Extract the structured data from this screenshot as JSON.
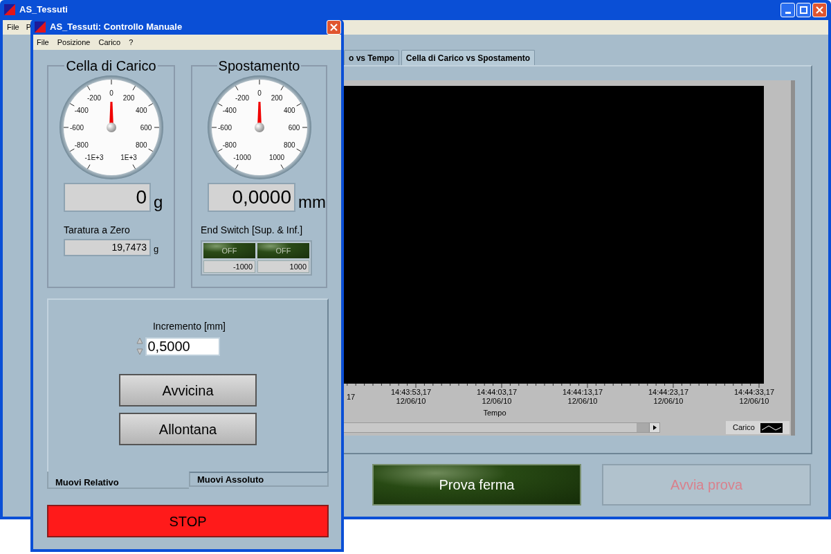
{
  "main_window": {
    "title": "AS_Tessuti",
    "menu": [
      "File",
      "P"
    ],
    "tabs": [
      {
        "label": "o vs Tempo",
        "selected": false
      },
      {
        "label": "Cella di Carico vs Spostamento",
        "selected": true
      }
    ],
    "graph": {
      "x_ticks": [
        {
          "time": "17"
        },
        {
          "time": "14:43:53,17",
          "date": "12/06/10"
        },
        {
          "time": "14:44:03,17",
          "date": "12/06/10"
        },
        {
          "time": "14:44:13,17",
          "date": "12/06/10"
        },
        {
          "time": "14:44:23,17",
          "date": "12/06/10"
        },
        {
          "time": "14:44:33,17",
          "date": "12/06/10"
        }
      ],
      "x_label": "Tempo",
      "legend": "Carico"
    },
    "buttons": [
      {
        "label": "Prova ferma",
        "kind": "led",
        "disabled": false
      },
      {
        "label": "Avvia prova",
        "kind": "plain",
        "disabled": true
      }
    ]
  },
  "dialog": {
    "title": "AS_Tessuti: Controllo Manuale",
    "menu": [
      "File",
      "Posizione",
      "Carico",
      "?"
    ],
    "gauges": [
      {
        "title": "Cella di Carico",
        "scale": [
          "-1E+3",
          "-800",
          "-600",
          "-400",
          "-200",
          "0",
          "200",
          "400",
          "600",
          "800",
          "1E+3"
        ],
        "level": 0.5,
        "reading": "0",
        "unit": "g"
      },
      {
        "title": "Spostamento",
        "scale": [
          "-1000",
          "-800",
          "-600",
          "-400",
          "-200",
          "0",
          "200",
          "400",
          "600",
          "800",
          "1000"
        ],
        "level": 0.5,
        "reading": "0,0000",
        "unit": "mm"
      }
    ],
    "zero_calibration": {
      "label": "Taratura a Zero",
      "value": "19,7473",
      "unit": "g"
    },
    "end_switch": {
      "label": "End Switch [Sup. & Inf.]",
      "switches": [
        {
          "label": "OFF",
          "on": false,
          "limit": "-1000"
        },
        {
          "label": "OFF",
          "on": false,
          "limit": "1000"
        }
      ]
    },
    "increment": {
      "label": "Incremento [mm]",
      "value": "0,5000"
    },
    "move_buttons": [
      "Avvicina",
      "Allontana"
    ],
    "tabs": [
      {
        "label": "Muovi Relativo",
        "selected": true
      },
      {
        "label": "Muovi Assoluto",
        "selected": false
      }
    ],
    "stop_button": "STOP"
  }
}
